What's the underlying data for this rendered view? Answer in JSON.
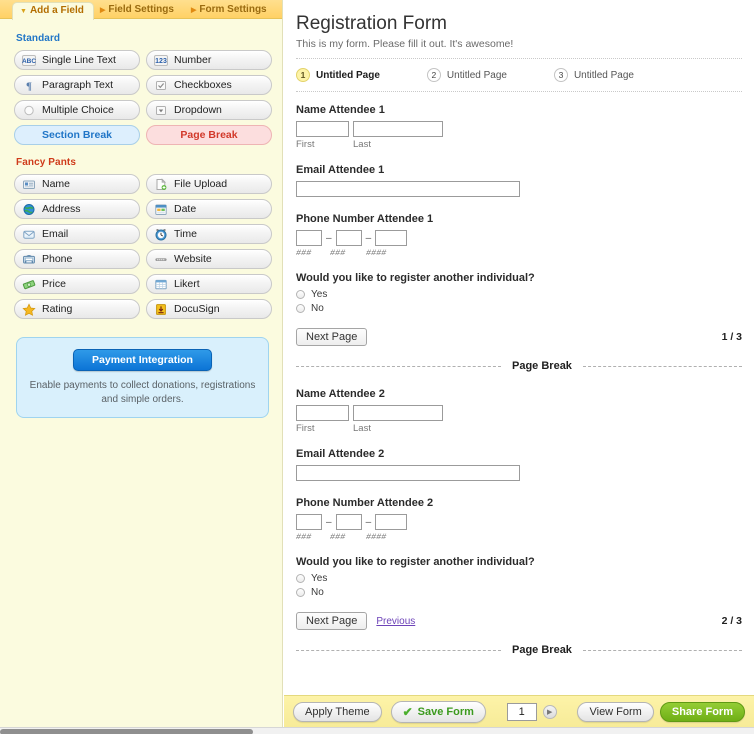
{
  "tabs": [
    {
      "id": "add-a-field",
      "label": "Add a Field",
      "active": true
    },
    {
      "id": "field-settings",
      "label": "Field Settings",
      "active": false
    },
    {
      "id": "form-settings",
      "label": "Form Settings",
      "active": false
    }
  ],
  "sidebar": {
    "standard_title": "Standard",
    "standard_items": [
      {
        "label": "Single Line Text",
        "icon": "abc-icon"
      },
      {
        "label": "Number",
        "icon": "123-icon"
      },
      {
        "label": "Paragraph Text",
        "icon": "pilcrow-icon"
      },
      {
        "label": "Checkboxes",
        "icon": "checkbox-icon"
      },
      {
        "label": "Multiple Choice",
        "icon": "radio-icon"
      },
      {
        "label": "Dropdown",
        "icon": "dropdown-icon"
      }
    ],
    "section_break_label": "Section Break",
    "page_break_label": "Page Break",
    "fancy_title": "Fancy Pants",
    "fancy_items": [
      {
        "label": "Name",
        "icon": "contact-card-icon"
      },
      {
        "label": "File Upload",
        "icon": "file-upload-icon"
      },
      {
        "label": "Address",
        "icon": "globe-icon"
      },
      {
        "label": "Date",
        "icon": "calendar-icon"
      },
      {
        "label": "Email",
        "icon": "envelope-icon"
      },
      {
        "label": "Time",
        "icon": "clock-icon"
      },
      {
        "label": "Phone",
        "icon": "phone-icon"
      },
      {
        "label": "Website",
        "icon": "link-icon"
      },
      {
        "label": "Price",
        "icon": "money-icon"
      },
      {
        "label": "Likert",
        "icon": "grid-icon"
      },
      {
        "label": "Rating",
        "icon": "star-icon"
      },
      {
        "label": "DocuSign",
        "icon": "docusign-icon"
      }
    ],
    "payment": {
      "button_label": "Payment Integration",
      "description": "Enable payments to collect donations, registrations and simple orders."
    }
  },
  "form": {
    "title": "Registration Form",
    "description": "This is my form. Please fill it out. It's awesome!",
    "page_tabs": [
      {
        "number": "1",
        "label": "Untitled Page",
        "active": true
      },
      {
        "number": "2",
        "label": "Untitled Page",
        "active": false
      },
      {
        "number": "3",
        "label": "Untitled Page",
        "active": false
      }
    ],
    "page_break_label": "Page Break",
    "pages": [
      {
        "name_label": "Name Attendee 1",
        "name_first_value": "",
        "name_last_value": "",
        "sub_first": "First",
        "sub_last": "Last",
        "email_label": "Email Attendee 1",
        "email_value": "",
        "phone_label": "Phone Number Attendee 1",
        "phone_area_value": "",
        "phone_prefix_value": "",
        "phone_line_value": "",
        "phone_hint_area": "###",
        "phone_hint_prefix": "###",
        "phone_hint_line": "####",
        "radio_label": "Would you like to register another individual?",
        "radio_yes": "Yes",
        "radio_no": "No",
        "next_label": "Next Page",
        "prev_label": "",
        "counter": "1 / 3"
      },
      {
        "name_label": "Name Attendee 2",
        "name_first_value": "",
        "name_last_value": "",
        "sub_first": "First",
        "sub_last": "Last",
        "email_label": "Email Attendee 2",
        "email_value": "",
        "phone_label": "Phone Number Attendee 2",
        "phone_area_value": "",
        "phone_prefix_value": "",
        "phone_line_value": "",
        "phone_hint_area": "###",
        "phone_hint_prefix": "###",
        "phone_hint_line": "####",
        "radio_label": "Would you like to register another individual?",
        "radio_yes": "Yes",
        "radio_no": "No",
        "next_label": "Next Page",
        "prev_label": "Previous",
        "counter": "2 / 3"
      }
    ]
  },
  "bottom_bar": {
    "apply_theme_label": "Apply Theme",
    "save_form_label": "Save Form",
    "save_check_glyph": "✔",
    "page_value": "1",
    "stepper_glyph": "▶",
    "view_form_label": "View Form",
    "share_form_label": "Share Form"
  },
  "colors": {
    "tabbar": "#ffd873",
    "panel_bg": "#fbfbdf",
    "standard_heading": "#2176c7",
    "fancy_heading": "#cf3b1b",
    "section_break": "#2176c7",
    "page_break": "#d2392a",
    "payment_btn": "#0c74d6",
    "save_green": "#3c9a1e",
    "share_green": "#6faf16",
    "prev_link": "#6d43b8",
    "active_page_num": "#fdf3a8"
  }
}
